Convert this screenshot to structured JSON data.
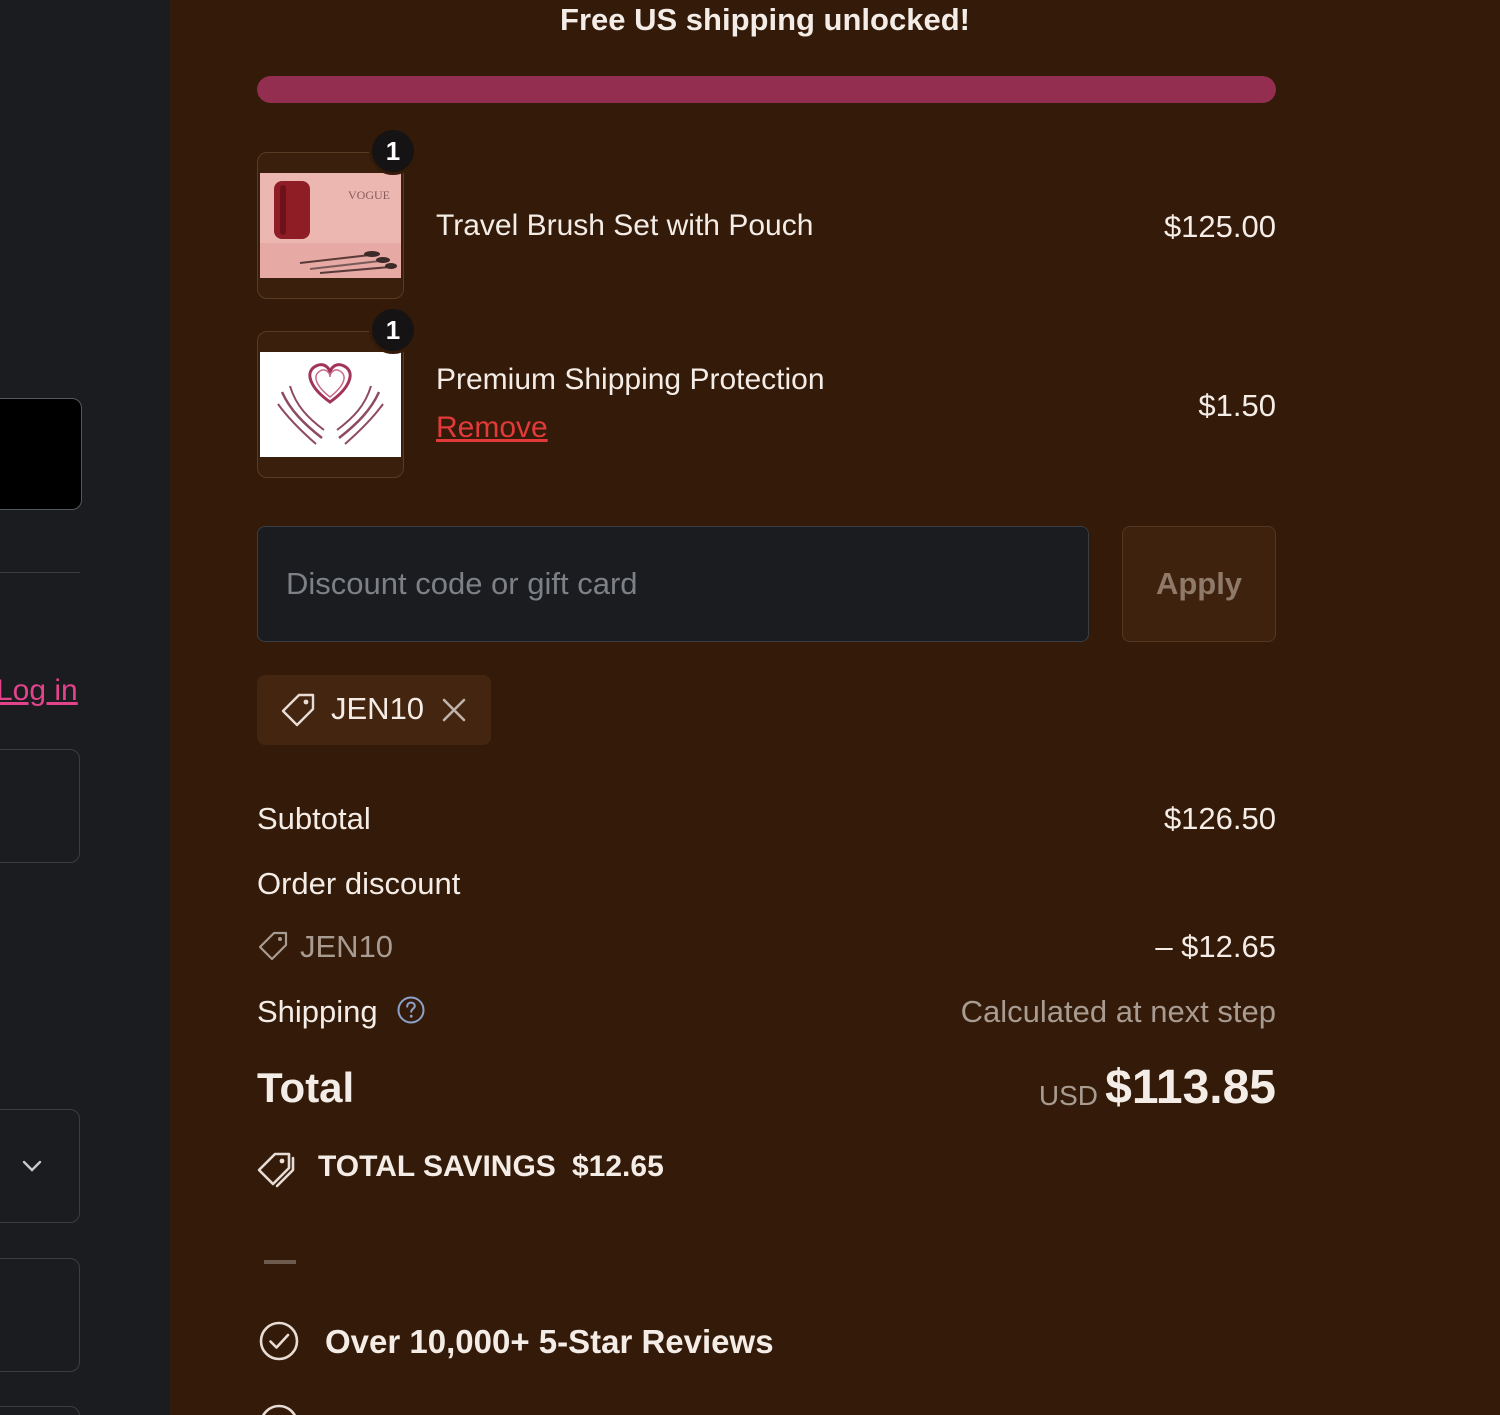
{
  "left_panel": {
    "login_link": "Log in"
  },
  "summary": {
    "free_shipping_message": "Free US shipping unlocked!",
    "shipping_progress_percent": 100,
    "colors": {
      "background": "#341a08",
      "progress": "#942e50",
      "remove_link": "#e03a3a",
      "login_link": "#e2438b"
    },
    "items": [
      {
        "name": "Travel Brush Set with Pouch",
        "price": "$125.00",
        "quantity": "1",
        "image_icon": "brush-set-product-image"
      },
      {
        "name": "Premium Shipping Protection",
        "price": "$1.50",
        "quantity": "1",
        "remove_label": "Remove",
        "image_icon": "heart-hands-product-image"
      }
    ],
    "discount": {
      "placeholder": "Discount code or gift card",
      "apply_label": "Apply",
      "applied_code": "JEN10"
    },
    "totals": {
      "subtotal_label": "Subtotal",
      "subtotal_value": "$126.50",
      "order_discount_label": "Order discount",
      "discount_code": "JEN10",
      "discount_value": "– $12.65",
      "shipping_label": "Shipping",
      "shipping_value": "Calculated at next step",
      "total_label": "Total",
      "currency": "USD",
      "total_value": "$113.85",
      "savings_label": "TOTAL SAVINGS",
      "savings_value": "$12.65"
    },
    "trust": {
      "reviews_text": "Over 10,000+ 5-Star Reviews"
    }
  }
}
